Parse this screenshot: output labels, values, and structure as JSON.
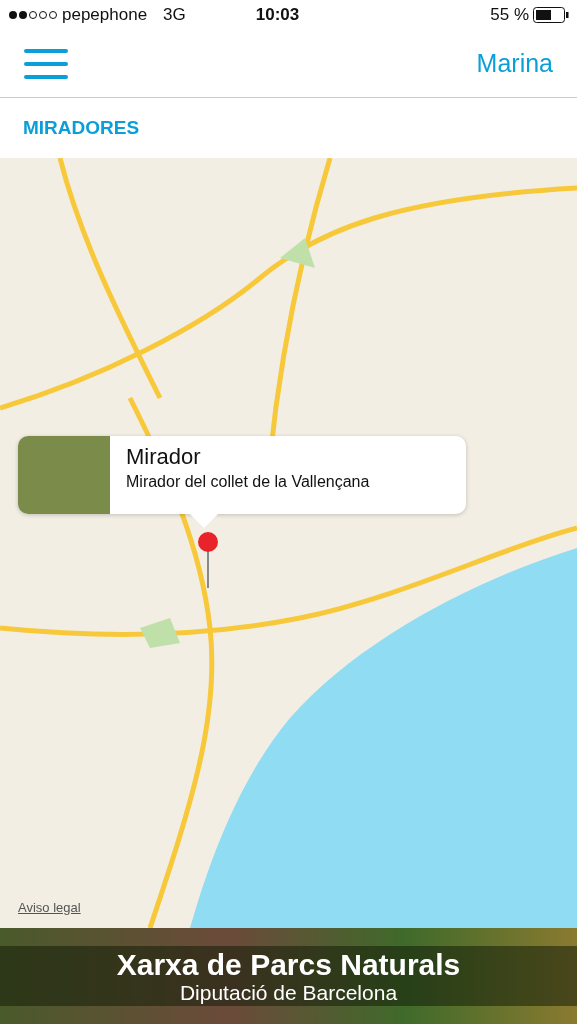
{
  "status_bar": {
    "carrier": "pepephone",
    "network": "3G",
    "time": "10:03",
    "battery": "55 %"
  },
  "nav": {
    "right_link": "Marina"
  },
  "section_title": "MIRADORES",
  "map": {
    "legal_link": "Aviso legal",
    "callout": {
      "title": "Mirador",
      "subtitle": "Mirador del collet de la Vallençana"
    }
  },
  "banner": {
    "title": "Xarxa de Parcs Naturals",
    "subtitle": "Diputació de Barcelona"
  }
}
